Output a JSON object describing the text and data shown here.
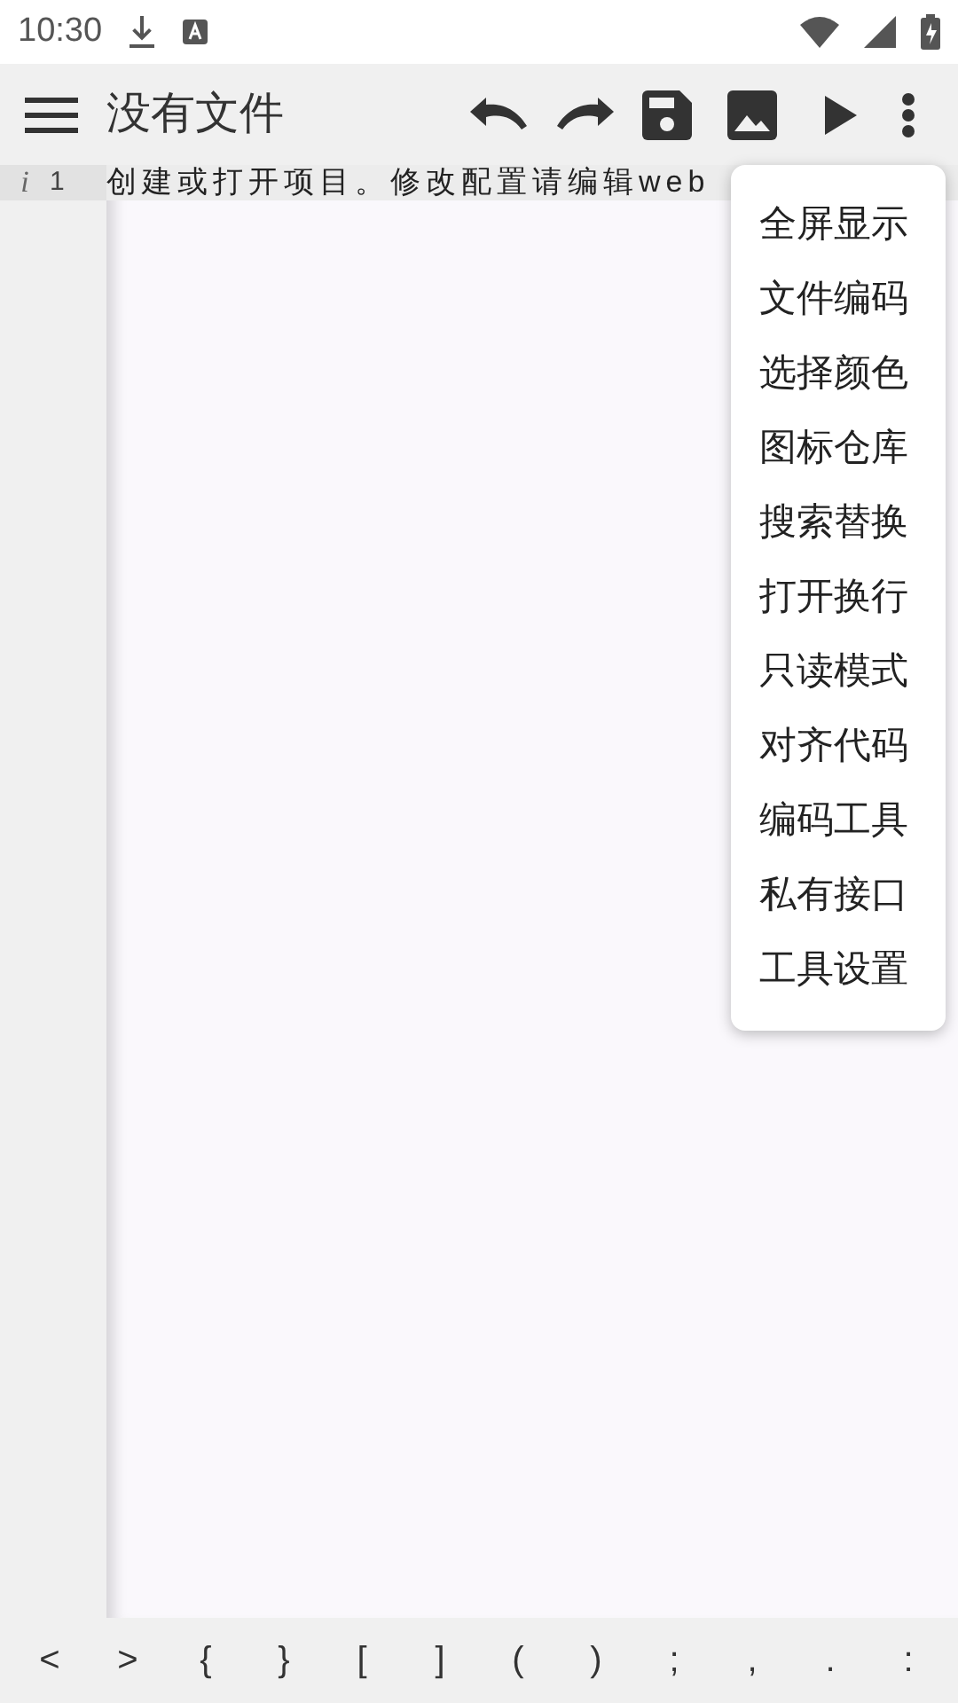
{
  "status_bar": {
    "time": "10:30"
  },
  "toolbar": {
    "title": "没有文件"
  },
  "editor": {
    "lines": [
      {
        "marker": "i",
        "number": "1",
        "text": "创建或打开项目。修改配置请编辑web"
      }
    ]
  },
  "menu": {
    "items": [
      {
        "label": "全屏显示"
      },
      {
        "label": "文件编码"
      },
      {
        "label": "选择颜色"
      },
      {
        "label": "图标仓库"
      },
      {
        "label": "搜索替换"
      },
      {
        "label": "打开换行"
      },
      {
        "label": "只读模式"
      },
      {
        "label": "对齐代码"
      },
      {
        "label": "编码工具"
      },
      {
        "label": "私有接口"
      },
      {
        "label": "工具设置"
      }
    ]
  },
  "symbol_bar": {
    "keys": [
      "<",
      ">",
      "{",
      "}",
      "[",
      "]",
      "(",
      ")",
      ";",
      ",",
      ".",
      ":"
    ]
  }
}
